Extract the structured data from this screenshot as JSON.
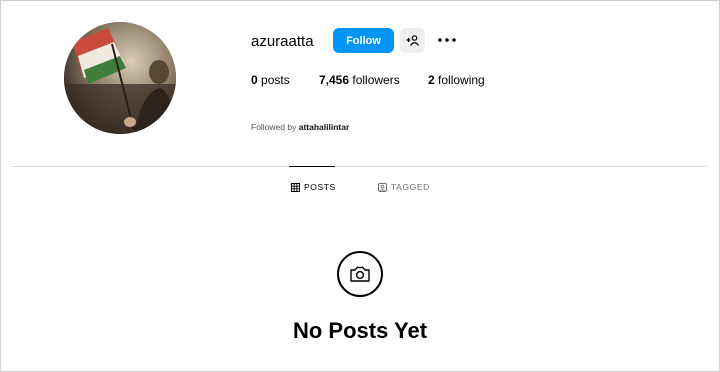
{
  "profile": {
    "username": "azuraatta",
    "follow_label": "Follow",
    "add_user_icon": "add-user-icon",
    "more_icon": "more-horizontal-icon"
  },
  "stats": {
    "posts_count": "0",
    "posts_label": " posts",
    "followers_count": "7,456",
    "followers_label": " followers",
    "following_count": "2",
    "following_label": " following"
  },
  "followed_by": {
    "prefix": "Followed by ",
    "user": "attahalilintar"
  },
  "tabs": [
    {
      "label": "POSTS",
      "icon": "grid-icon",
      "active": true
    },
    {
      "label": "TAGGED",
      "icon": "tagged-icon",
      "active": false
    }
  ],
  "empty_state": {
    "icon": "camera-icon",
    "title": "No Posts Yet"
  },
  "colors": {
    "accent": "#0095f6",
    "divider": "#dbdbdb",
    "muted": "#737373"
  }
}
